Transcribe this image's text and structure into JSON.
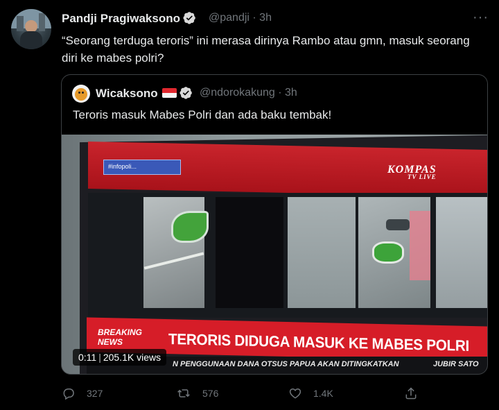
{
  "tweet": {
    "author_name": "Pandji Pragiwaksono",
    "handle_time": "@pandji · 3h",
    "text": "“Seorang terduga teroris” ini merasa dirinya Rambo atau gmn, masuk seorang diri ke mabes polri?"
  },
  "quoted": {
    "author_name": "Wicaksono",
    "handle_time": "@ndorokakung · 3h",
    "text": "Teroris masuk Mabes Polri dan ada baku tembak!"
  },
  "video": {
    "hashtag": "#infopoli...",
    "channel": "KOMPAS",
    "channel_suffix": "TV LIVE",
    "breaking_line1": "BREAKING",
    "breaking_line2": "NEWS",
    "headline": "TERORIS DIDUGA MASUK KE MABES POLRI",
    "ticker": "N PENGGUNAAN DANA OTSUS PAPUA AKAN DITINGKATKAN",
    "ticker_right": "JUBIR SATO",
    "time": "0:11",
    "views": "205.1K views"
  },
  "actions": {
    "replies": "327",
    "retweets": "576",
    "likes": "1.4K"
  },
  "colors": {
    "background": "#000000",
    "muted": "#71767b",
    "text": "#e7e9ea",
    "verified": "#d9d9d9"
  }
}
